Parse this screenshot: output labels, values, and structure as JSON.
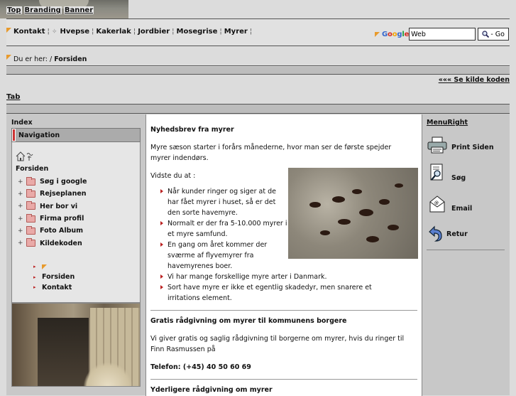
{
  "banner": {
    "links": [
      "Top",
      "Branding",
      "Banner"
    ]
  },
  "nav": {
    "items": [
      "Kontakt",
      "Hvepse",
      "Kakerlak",
      "Jordbier",
      "Mosegrise",
      "Myrer"
    ],
    "separator": "¦"
  },
  "search": {
    "logo": "Google",
    "value": "Web",
    "button_label": "- Go",
    "button_icon": "magnifier-icon"
  },
  "breadcrumb": {
    "prefix": "Du er her: /",
    "current": "Forsiden"
  },
  "source_link": "««« Se kilde koden",
  "tab_link": "Tab",
  "left": {
    "index_title": "Index",
    "nav_header": "Navigation",
    "tree_root": "Forsiden",
    "tree_items": [
      "Søg i google",
      "Rejseplanen",
      "Her bor vi",
      "Firma profil",
      "Foto Album",
      "Kildekoden"
    ],
    "sub_links": [
      "Forsiden",
      "Kontakt"
    ]
  },
  "main": {
    "heading1": "Nyhedsbrev fra myrer",
    "para1": "Myre sæson starter i forårs månederne, hvor man ser de første spejder myrer indendørs.",
    "did_you_know": "Vidste du at :",
    "facts": [
      "Når kunder ringer og siger at de har fået myrer i huset, så er det den sorte havemyre.",
      "Normalt er der fra 5-10.000 myrer i et myre samfund.",
      "En gang om året kommer der sværme af flyvemyrer fra havemyrenes boer.",
      "Vi har mange forskellige myre arter i Danmark.",
      "Sort have myre er ikke et egentlig skadedyr, men snarere et irritations element."
    ],
    "heading2": "Gratis rådgivning om myrer til kommunens borgere",
    "para2": "Vi giver gratis og saglig rådgivning til borgerne om myrer, hvis du ringer til Finn Rasmussen på",
    "phone": "Telefon: (+45) 40 50 60 69",
    "heading3": "Yderligere rådgivning om myrer"
  },
  "right": {
    "title": "MenuRight",
    "items": [
      {
        "label": "Print Siden",
        "icon": "printer-icon"
      },
      {
        "label": "Søg",
        "icon": "search-document-icon"
      },
      {
        "label": "Email",
        "icon": "envelope-icon"
      },
      {
        "label": "Retur",
        "icon": "return-arrow-icon"
      }
    ]
  },
  "colors": {
    "accent_orange": "#e89a2c",
    "bullet_red": "#bb2222",
    "folder_pink": "#e9aaa8"
  }
}
